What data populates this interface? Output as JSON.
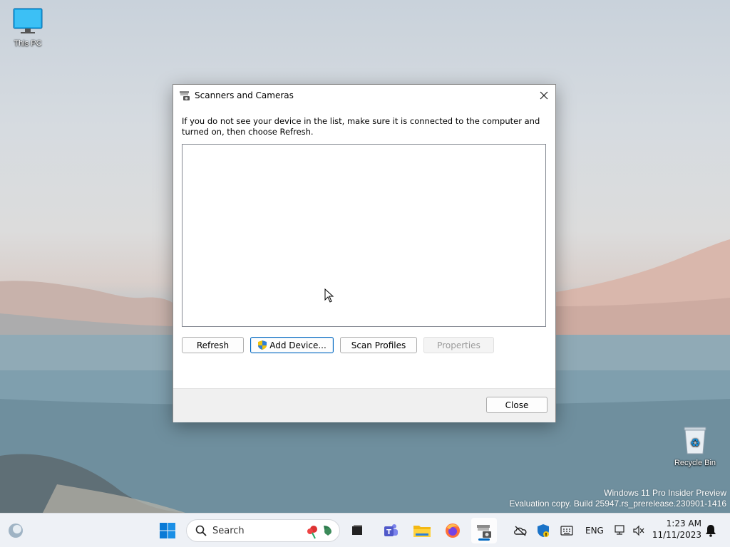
{
  "desktop": {
    "this_pc_label": "This PC",
    "recycle_bin_label": "Recycle Bin",
    "watermark_line1": "Windows 11 Pro Insider Preview",
    "watermark_line2": "Evaluation copy. Build 25947.rs_prerelease.230901-1416"
  },
  "dialog": {
    "title": "Scanners and Cameras",
    "instructions": "If you do not see your device in the list, make sure it is connected to the computer and turned on, then choose Refresh.",
    "devices": [],
    "buttons": {
      "refresh": "Refresh",
      "add_device": "Add Device...",
      "scan_profiles": "Scan Profiles",
      "properties": "Properties",
      "close": "Close"
    }
  },
  "taskbar": {
    "search_placeholder": "Search",
    "language": "ENG",
    "time": "1:23 AM",
    "date": "11/11/2023"
  },
  "colors": {
    "accent": "#0067c0",
    "taskbar_bg": "#eef1f6"
  }
}
